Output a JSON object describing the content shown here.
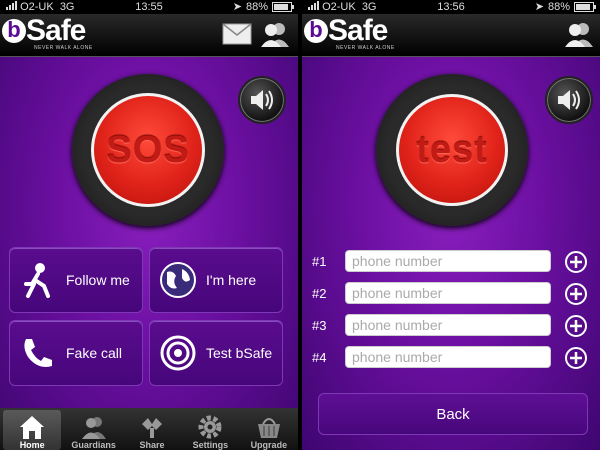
{
  "left": {
    "status": {
      "carrier": "O2-UK",
      "network": "3G",
      "time": "13:55",
      "battery": "88%"
    },
    "logo": {
      "word": "Safe",
      "tagline": "NEVER WALK ALONE"
    },
    "sos_label": "SOS",
    "tiles": [
      {
        "label": "Follow me",
        "icon": "running-person-icon"
      },
      {
        "label": "I'm here",
        "icon": "globe-icon"
      },
      {
        "label": "Fake call",
        "icon": "phone-handset-icon"
      },
      {
        "label": "Test bSafe",
        "icon": "target-icon"
      }
    ],
    "tabs": [
      {
        "label": "Home",
        "icon": "home-icon",
        "active": true
      },
      {
        "label": "Guardians",
        "icon": "guardians-icon"
      },
      {
        "label": "Share",
        "icon": "share-icon"
      },
      {
        "label": "Settings",
        "icon": "gear-icon"
      },
      {
        "label": "Upgrade",
        "icon": "basket-icon"
      }
    ]
  },
  "right": {
    "status": {
      "carrier": "O2-UK",
      "network": "3G",
      "time": "13:56",
      "battery": "88%"
    },
    "logo": {
      "word": "Safe",
      "tagline": "NEVER WALK ALONE"
    },
    "test_label": "test",
    "phone_rows": [
      {
        "num": "#1",
        "placeholder": "phone number"
      },
      {
        "num": "#2",
        "placeholder": "phone number"
      },
      {
        "num": "#3",
        "placeholder": "phone number"
      },
      {
        "num": "#4",
        "placeholder": "phone number"
      }
    ],
    "back_label": "Back"
  },
  "colors": {
    "purple": "#6a0fa0",
    "red_button": "#e0231a",
    "tile": "#52098a"
  }
}
